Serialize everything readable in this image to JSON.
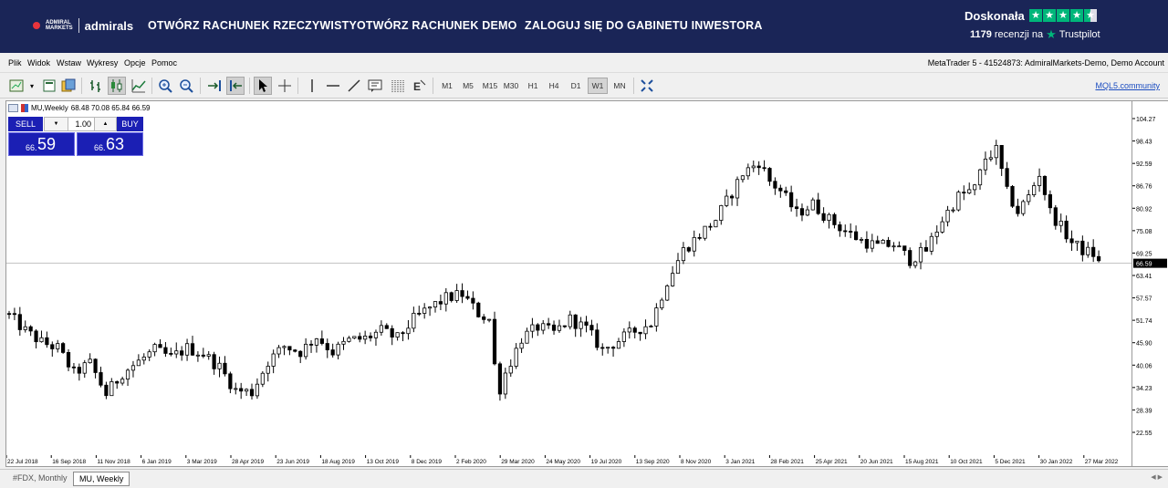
{
  "banner": {
    "logo_top": "ADMIRAL",
    "logo_bottom": "MARKETS",
    "logo_name": "admirals",
    "links": [
      "OTWÓRZ RACHUNEK RZECZYWISTY",
      "OTWÓRZ RACHUNEK DEMO",
      "ZALOGUJ SIĘ DO GABINETU INWESTORA"
    ],
    "trustpilot": {
      "rating_text": "Doskonała",
      "reviews_count": "1179",
      "reviews_text": "recenzji na",
      "brand": "Trustpilot",
      "stars": 4.5,
      "star_color": "#00b67a"
    }
  },
  "menubar": {
    "items": [
      "Plik",
      "Widok",
      "Wstaw",
      "Wykresy",
      "Opcje",
      "Pomoc"
    ],
    "account": "MetaTrader 5 - 41524873: AdmiralMarkets-Demo, Demo Account"
  },
  "toolbar": {
    "icons": [
      "new-chart-icon",
      "dropdown-icon",
      "profiles-icon",
      "templates-icon",
      "bar-chart-icon",
      "candlestick-icon",
      "line-chart-icon",
      "zoom-in-icon",
      "zoom-out-icon",
      "auto-scroll-icon",
      "chart-shift-icon",
      "cursor-icon",
      "crosshair-icon",
      "vertical-line-icon",
      "horizontal-line-icon",
      "trend-line-icon",
      "text-icon",
      "fibonacci-icon",
      "objects-icon",
      "tile-windows-icon"
    ],
    "timeframes": [
      "M1",
      "M5",
      "M15",
      "M30",
      "H1",
      "H4",
      "D1",
      "W1",
      "MN"
    ],
    "active_timeframe": "W1",
    "community_link": "MQL5.community"
  },
  "symbol": {
    "name": "MU,Weekly",
    "ohlc": "68.48 70.08 65.84 66.59"
  },
  "one_click": {
    "sell_label": "SELL",
    "buy_label": "BUY",
    "volume": "1.00",
    "sell_price_small": "66.",
    "sell_price_big": "59",
    "buy_price_small": "66.",
    "buy_price_big": "63",
    "color": "#1b1fb4"
  },
  "chart_data": {
    "type": "candlestick",
    "symbol": "MU",
    "period": "Weekly",
    "current_price": 66.59,
    "y_ticks": [
      104.27,
      98.43,
      92.59,
      86.76,
      80.92,
      75.08,
      69.25,
      63.41,
      57.57,
      51.74,
      45.9,
      40.06,
      34.23,
      28.39,
      22.55
    ],
    "x_ticks": [
      "22 Jul 2018",
      "16 Sep 2018",
      "11 Nov 2018",
      "6 Jan 2019",
      "3 Mar 2019",
      "28 Apr 2019",
      "23 Jun 2019",
      "18 Aug 2019",
      "13 Oct 2019",
      "8 Dec 2019",
      "2 Feb 2020",
      "29 Mar 2020",
      "24 May 2020",
      "19 Jul 2020",
      "13 Sep 2020",
      "8 Nov 2020",
      "3 Jan 2021",
      "28 Feb 2021",
      "25 Apr 2021",
      "20 Jun 2021",
      "15 Aug 2021",
      "10 Oct 2021",
      "5 Dec 2021",
      "30 Jan 2022",
      "27 Mar 2022"
    ],
    "ylim": [
      20.0,
      106.0
    ],
    "bull_color": "#ffffff",
    "bear_color": "#000000",
    "close_path": [
      [
        0,
        53.0
      ],
      [
        3,
        49.0
      ],
      [
        6,
        46.0
      ],
      [
        9,
        44.5
      ],
      [
        12,
        38.0
      ],
      [
        15,
        40.5
      ],
      [
        18,
        32.5
      ],
      [
        21,
        38.0
      ],
      [
        24,
        41.0
      ],
      [
        27,
        44.0
      ],
      [
        30,
        42.0
      ],
      [
        33,
        44.5
      ],
      [
        36,
        43.0
      ],
      [
        39,
        39.5
      ],
      [
        42,
        33.5
      ],
      [
        45,
        33.0
      ],
      [
        48,
        41.0
      ],
      [
        51,
        45.0
      ],
      [
        54,
        43.5
      ],
      [
        57,
        47.5
      ],
      [
        60,
        43.5
      ],
      [
        63,
        46.5
      ],
      [
        66,
        47.0
      ],
      [
        69,
        49.0
      ],
      [
        72,
        47.0
      ],
      [
        75,
        52.0
      ],
      [
        78,
        55.0
      ],
      [
        81,
        57.5
      ],
      [
        84,
        58.5
      ],
      [
        87,
        53.5
      ],
      [
        89,
        52.0
      ],
      [
        90,
        40.0
      ],
      [
        91,
        34.0
      ],
      [
        92,
        38.0
      ],
      [
        95,
        47.0
      ],
      [
        98,
        50.0
      ],
      [
        101,
        48.5
      ],
      [
        104,
        52.0
      ],
      [
        107,
        49.5
      ],
      [
        110,
        44.0
      ],
      [
        113,
        46.5
      ],
      [
        116,
        49.0
      ],
      [
        119,
        51.0
      ],
      [
        122,
        62.0
      ],
      [
        125,
        70.0
      ],
      [
        128,
        74.0
      ],
      [
        131,
        78.0
      ],
      [
        134,
        85.0
      ],
      [
        136,
        90.0
      ],
      [
        139,
        93.0
      ],
      [
        141,
        88.0
      ],
      [
        143,
        85.5
      ],
      [
        146,
        79.5
      ],
      [
        149,
        82.0
      ],
      [
        152,
        78.0
      ],
      [
        155,
        75.0
      ],
      [
        158,
        72.5
      ],
      [
        161,
        71.0
      ],
      [
        164,
        71.5
      ],
      [
        167,
        67.5
      ],
      [
        170,
        70.0
      ],
      [
        173,
        78.0
      ],
      [
        176,
        84.0
      ],
      [
        179,
        86.0
      ],
      [
        181,
        94.0
      ],
      [
        183,
        96.0
      ],
      [
        185,
        85.0
      ],
      [
        187,
        80.0
      ],
      [
        189,
        84.0
      ],
      [
        191,
        90.0
      ],
      [
        193,
        80.0
      ],
      [
        195,
        76.0
      ],
      [
        197,
        72.0
      ],
      [
        199,
        70.0
      ],
      [
        201,
        69.0
      ],
      [
        202,
        66.59
      ]
    ]
  },
  "tabs": [
    "#FDX, Monthly",
    "MU, Weekly"
  ],
  "active_tab": "MU, Weekly"
}
